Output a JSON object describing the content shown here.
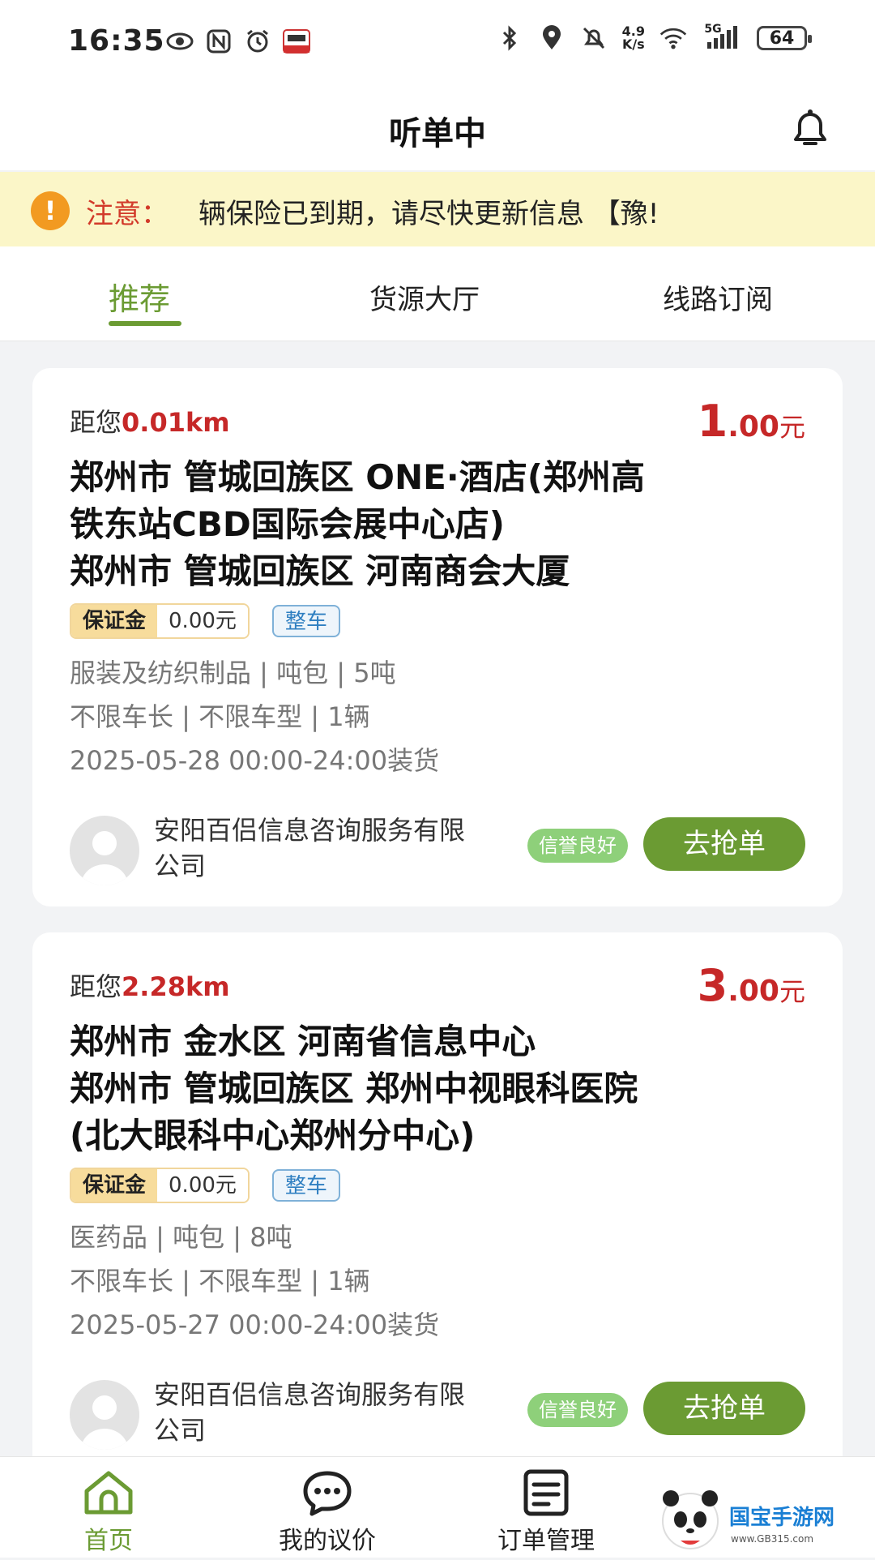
{
  "status_bar": {
    "time": "16:35",
    "speed_top": "4.9",
    "speed_bottom": "K/s",
    "network": "5G",
    "battery": "64"
  },
  "header": {
    "title": "听单中"
  },
  "notice": {
    "label": "注意：",
    "text": "辆保险已到期，请尽快更新信息      【豫!"
  },
  "tabs": [
    {
      "label": "推荐"
    },
    {
      "label": "货源大厅"
    },
    {
      "label": "线路订阅"
    }
  ],
  "orders": [
    {
      "distance_prefix": "距您",
      "distance": "0.01km",
      "price_int": "1",
      "price_dec": ".00",
      "price_unit": "元",
      "route_lines": [
        "郑州市 管城回族区 ONE·酒店(郑州高",
        "铁东站CBD国际会展中心店)",
        "郑州市 管城回族区 河南商会大厦"
      ],
      "deposit_label": "保证金",
      "deposit_value": "0.00元",
      "vehicle_tag": "整车",
      "goods": "服装及纺织制品 | 吨包 | 5吨",
      "vehicle": "不限车长 | 不限车型 | 1辆",
      "load_time": "2025-05-28 00:00-24:00装货",
      "company": "安阳百侣信息咨询服务有限公司",
      "credit": "信誉良好",
      "action": "去抢单"
    },
    {
      "distance_prefix": "距您",
      "distance": "2.28km",
      "price_int": "3",
      "price_dec": ".00",
      "price_unit": "元",
      "route_lines": [
        "郑州市 金水区 河南省信息中心",
        "郑州市 管城回族区 郑州中视眼科医院",
        "(北大眼科中心郑州分中心)"
      ],
      "deposit_label": "保证金",
      "deposit_value": "0.00元",
      "vehicle_tag": "整车",
      "goods": "医药品 | 吨包 | 8吨",
      "vehicle": "不限车长 | 不限车型 | 1辆",
      "load_time": "2025-05-27 00:00-24:00装货",
      "company": "安阳百侣信息咨询服务有限公司",
      "credit": "信誉良好",
      "action": "去抢单"
    }
  ],
  "bottom_nav": [
    {
      "label": "首页",
      "icon": "home-icon"
    },
    {
      "label": "我的议价",
      "icon": "chat-icon"
    },
    {
      "label": "订单管理",
      "icon": "order-list-icon"
    }
  ],
  "watermark": {
    "brand": "国宝手游网",
    "site": "www.GB315.com"
  },
  "colors": {
    "accent": "#6b9b33",
    "price": "#c62828",
    "notice_bg": "#fbf6c8"
  }
}
